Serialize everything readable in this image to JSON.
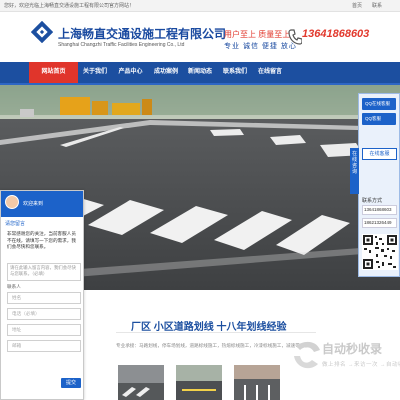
{
  "topbar": {
    "welcome": "您好，欢迎光临上海畅直交通设施工程有限公司官方网站！",
    "link_home": "首页",
    "link_contact": "联系"
  },
  "header": {
    "company_name": "上海畅直交通设施工程有限公司",
    "company_en": "Shanghai Changzhi Traffic Facilities Engineering Co., Ltd",
    "slogan_line1": "用户至上  质量至上",
    "slogan_line2": "专业  诚信  便捷  放心",
    "phone": "13641868603"
  },
  "nav": {
    "items": [
      {
        "label": "网站首页",
        "active": true
      },
      {
        "label": "关于我们",
        "active": false
      },
      {
        "label": "产品中心",
        "active": false
      },
      {
        "label": "成功案例",
        "active": false
      },
      {
        "label": "新闻动态",
        "active": false
      },
      {
        "label": "联系我们",
        "active": false
      },
      {
        "label": "在线留言",
        "active": false
      }
    ]
  },
  "side_float": {
    "qq1": "QQ在线客服",
    "qq2": "QQ客服",
    "online": "在线客服",
    "consult_tab": "在线咨询",
    "contact_title": "联系方式",
    "contact_lines": [
      "13641868603",
      "18621326449"
    ]
  },
  "chat": {
    "name": "欢迎来到",
    "tab": "请您留言",
    "message": "非常感谢您的关注，当前客服人员不在线，请填写一下您的需求，我们会尽快和您联系。",
    "textarea_placeholder": "请在此输入留言内容，我们会尽快与您联系。（必填）",
    "form_label": "联系人",
    "name_placeholder": "姓名",
    "phone_placeholder": "电话（必填）",
    "address_placeholder": "地址",
    "email_placeholder": "邮箱",
    "submit": "提交"
  },
  "section": {
    "title": "厂区 小区道路划线 十八年划线经验",
    "desc": "专业承接：马路划线，停车场划线，道路标线施工，热熔标线施工，冷漆标线施工，减速带安装等"
  },
  "watermark": {
    "text": "自动秒收录",
    "sub": "做上排名  →来访一次  →自动收录"
  },
  "colors": {
    "brand_blue": "#1c4fa0",
    "accent_red": "#e0352b",
    "qq_blue": "#1c62c9"
  }
}
